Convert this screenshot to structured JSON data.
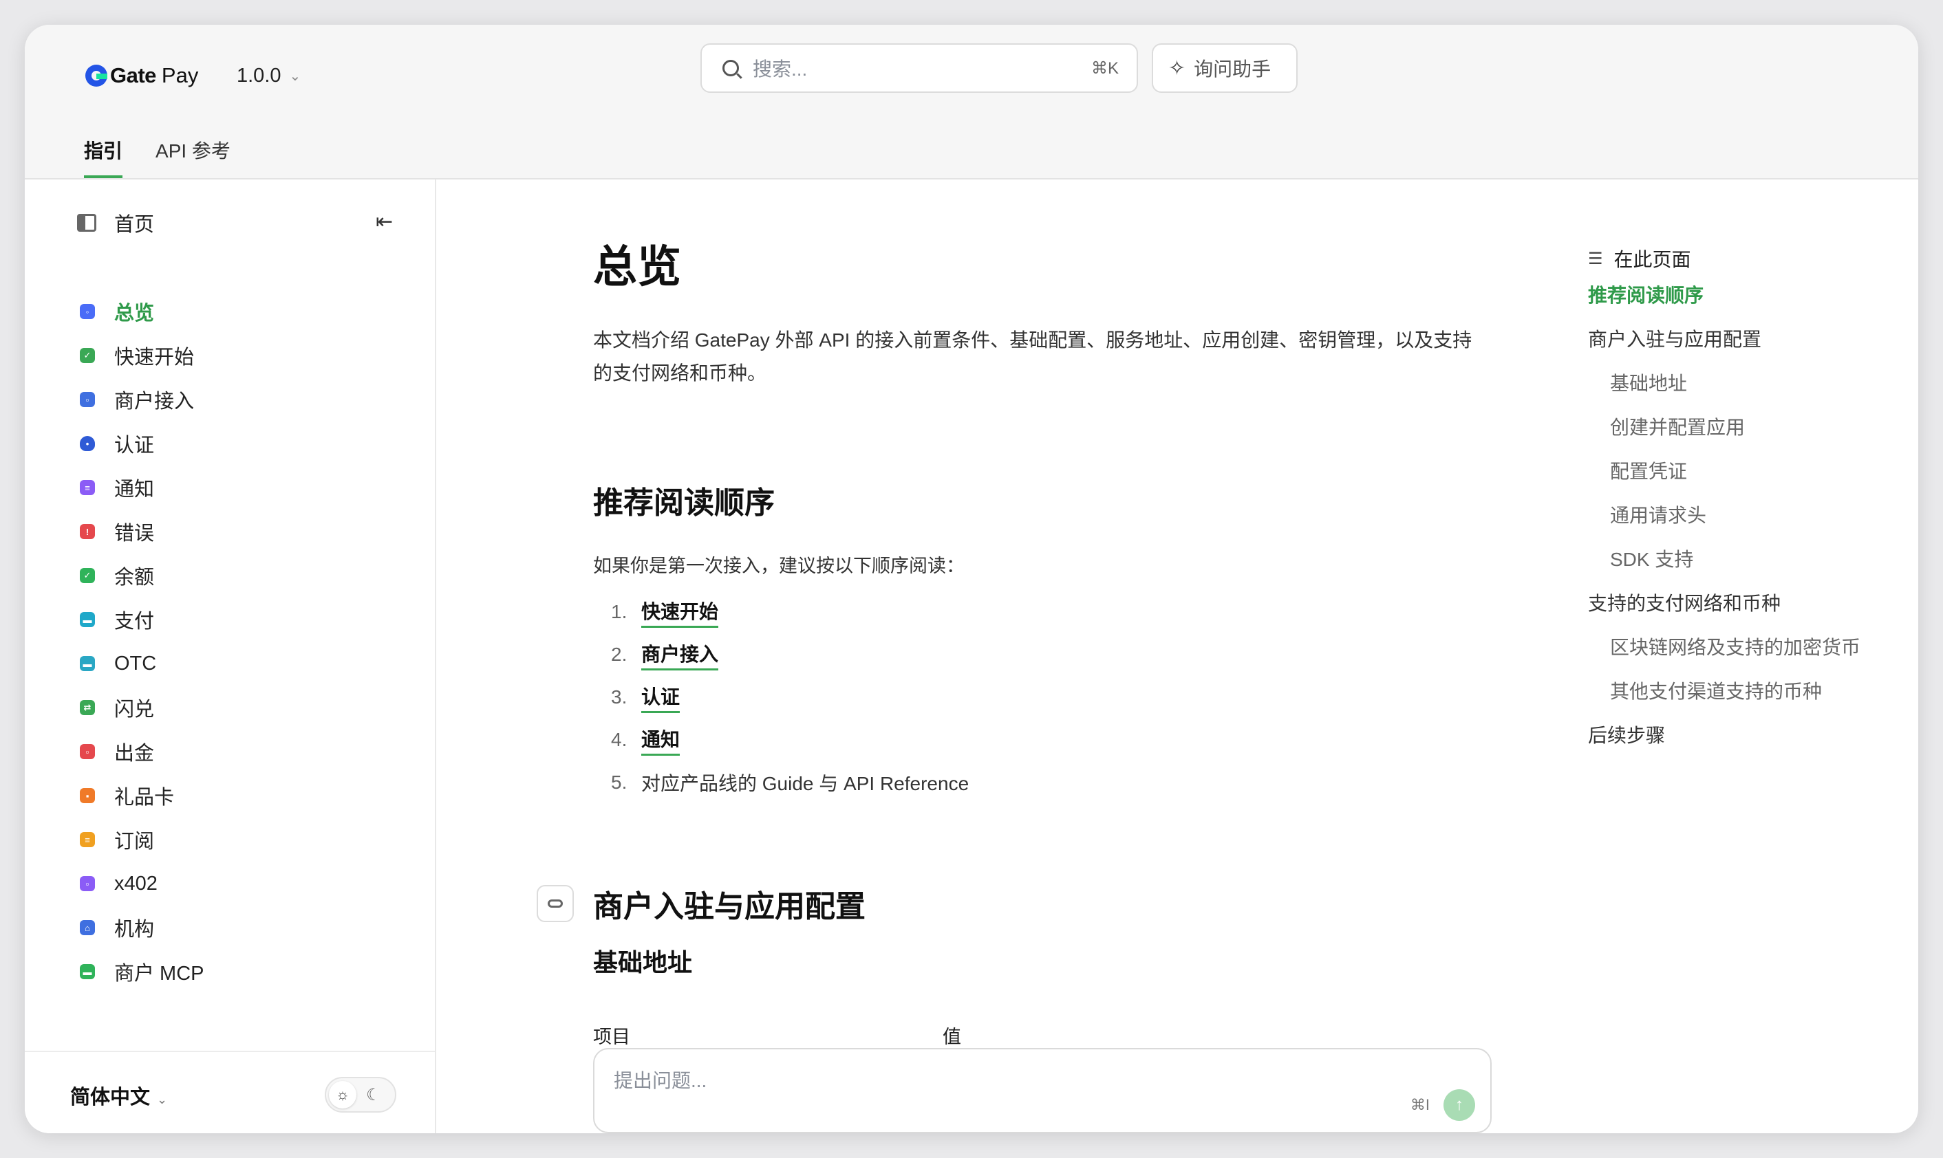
{
  "header": {
    "logo_name": "Gate",
    "logo_pay": "Pay",
    "version": "1.0.0",
    "search_placeholder": "搜索...",
    "search_shortcut": "⌘K",
    "ask_label": "询问助手",
    "tabs": [
      {
        "label": "指引",
        "active": true
      },
      {
        "label": "API 参考",
        "active": false
      }
    ]
  },
  "sidebar": {
    "home_label": "首页",
    "items": [
      {
        "label": "总览",
        "icon": "overview-icon",
        "color": "#4a6cf7",
        "active": true
      },
      {
        "label": "快速开始",
        "icon": "quickstart-icon",
        "color": "#3aa855"
      },
      {
        "label": "商户接入",
        "icon": "merchant-icon",
        "color": "#3f6fe0"
      },
      {
        "label": "认证",
        "icon": "shield-icon",
        "color": "#2f5bd6"
      },
      {
        "label": "通知",
        "icon": "notification-icon",
        "color": "#8b5cf6"
      },
      {
        "label": "错误",
        "icon": "warning-icon",
        "color": "#e5484d"
      },
      {
        "label": "余额",
        "icon": "balance-icon",
        "color": "#2fb35a"
      },
      {
        "label": "支付",
        "icon": "payment-icon",
        "color": "#1fa8c9"
      },
      {
        "label": "OTC",
        "icon": "otc-icon",
        "color": "#2aa7c4"
      },
      {
        "label": "闪兑",
        "icon": "swap-icon",
        "color": "#3aa855"
      },
      {
        "label": "出金",
        "icon": "withdraw-icon",
        "color": "#e5484d"
      },
      {
        "label": "礼品卡",
        "icon": "giftcard-icon",
        "color": "#f07a28"
      },
      {
        "label": "订阅",
        "icon": "subscription-icon",
        "color": "#f0a020"
      },
      {
        "label": "x402",
        "icon": "x402-icon",
        "color": "#8b5cf6"
      },
      {
        "label": "机构",
        "icon": "institution-icon",
        "color": "#3f6fe0"
      },
      {
        "label": "商户 MCP",
        "icon": "mcp-icon",
        "color": "#2fb35a"
      }
    ],
    "language": "简体中文"
  },
  "main": {
    "title": "总览",
    "intro": "本文档介绍 GatePay 外部 API 的接入前置条件、基础配置、服务地址、应用创建、密钥管理，以及支持的支付网络和币种。",
    "section1_title": "推荐阅读顺序",
    "section1_text": "如果你是第一次接入，建议按以下顺序阅读：",
    "reading_list": [
      {
        "num": "1.",
        "label": "快速开始",
        "link": true
      },
      {
        "num": "2.",
        "label": "商户接入",
        "link": true
      },
      {
        "num": "3.",
        "label": "认证",
        "link": true
      },
      {
        "num": "4.",
        "label": "通知",
        "link": true
      },
      {
        "num": "5.",
        "label": "对应产品线的 Guide 与 API Reference",
        "link": false
      }
    ],
    "section2_title": "商户入驻与应用配置",
    "section2_sub": "基础地址",
    "table_headers": [
      "项目",
      "值"
    ],
    "ask_placeholder": "提出问题...",
    "ask_shortcut": "⌘I"
  },
  "toc": {
    "heading": "在此页面",
    "items": [
      {
        "label": "推荐阅读顺序",
        "level": 1,
        "active": true
      },
      {
        "label": "商户入驻与应用配置",
        "level": 1
      },
      {
        "label": "基础地址",
        "level": 2
      },
      {
        "label": "创建并配置应用",
        "level": 2
      },
      {
        "label": "配置凭证",
        "level": 2
      },
      {
        "label": "通用请求头",
        "level": 2
      },
      {
        "label": "SDK 支持",
        "level": 2
      },
      {
        "label": "支持的支付网络和币种",
        "level": 1
      },
      {
        "label": "区块链网络及支持的加密货币",
        "level": 2
      },
      {
        "label": "其他支付渠道支持的币种",
        "level": 2
      },
      {
        "label": "后续步骤",
        "level": 1
      }
    ]
  },
  "colors": {
    "accent": "#3aa855",
    "brand": "#2354e6"
  }
}
